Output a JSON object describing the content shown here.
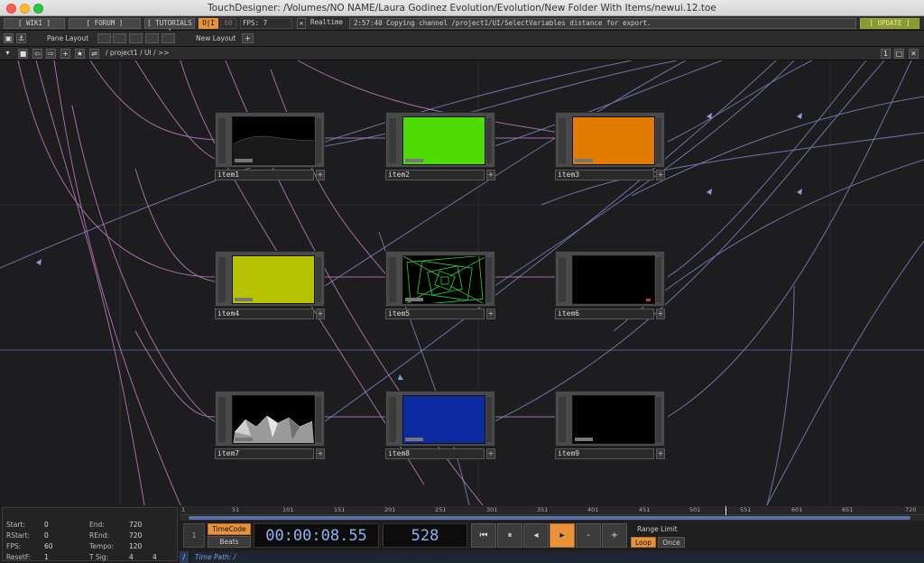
{
  "window": {
    "title": "TouchDesigner: /Volumes/NO NAME/Laura Godinez Evolution/Evolution/New Folder With Items/newui.12.toe"
  },
  "menubar": {
    "wiki": "[ WIKI ]",
    "forum": "[ FORUM ]",
    "tutorials": "[ TUTORIALS ]",
    "oi": "O|I",
    "num": "60",
    "fps": "FPS: 7",
    "realtime": "Realtime",
    "status": "2:57:40 Copying channel /project1/UI/SelectVariables distance for export.",
    "update": "[ UPDATE ]"
  },
  "toolbar": {
    "pane_layout": "Pane Layout",
    "new_layout": "New Layout",
    "plus": "+"
  },
  "pathbar": {
    "path": "/ project1 / UI / >>",
    "pane_num": "1"
  },
  "nodes": [
    {
      "label": "item1",
      "preview": "terrain"
    },
    {
      "label": "item2",
      "preview": "#4fdc04"
    },
    {
      "label": "item3",
      "preview": "#e27c00"
    },
    {
      "label": "item4",
      "preview": "#b5c200"
    },
    {
      "label": "item5",
      "preview": "tunnel"
    },
    {
      "label": "item6",
      "preview": "#000000"
    },
    {
      "label": "item7",
      "preview": "mesh"
    },
    {
      "label": "item8",
      "preview": "#0b2aa0"
    },
    {
      "label": "item9",
      "preview": "#000000"
    }
  ],
  "info": {
    "start_l": "Start:",
    "start_v": "0",
    "end_l": "End:",
    "end_v": "720",
    "rstart_l": "RStart:",
    "rstart_v": "0",
    "rend_l": "REnd:",
    "rend_v": "720",
    "fps_l": "FPS:",
    "fps_v": "60",
    "tempo_l": "Tempo:",
    "tempo_v": "120",
    "resetf_l": "ResetF:",
    "resetf_v": "1",
    "tsig_l": "T Sig:",
    "tsig_v1": "4",
    "tsig_v2": "4"
  },
  "ruler": [
    "1",
    "51",
    "101",
    "151",
    "201",
    "251",
    "301",
    "351",
    "401",
    "451",
    "501",
    "551",
    "601",
    "651",
    "720"
  ],
  "transport": {
    "timecode": "TimeCode",
    "beats": "Beats",
    "time": "00:00:08.55",
    "frame": "528",
    "minus": "-",
    "plus": "+",
    "range_limit": "Range Limit",
    "loop": "Loop",
    "once": "Once",
    "time_path": "Time Path: /",
    "left_num": "1"
  },
  "colors": {
    "accent": "#e8923a",
    "link_pink": "#c683c6",
    "link_blue": "#8f98d8"
  }
}
